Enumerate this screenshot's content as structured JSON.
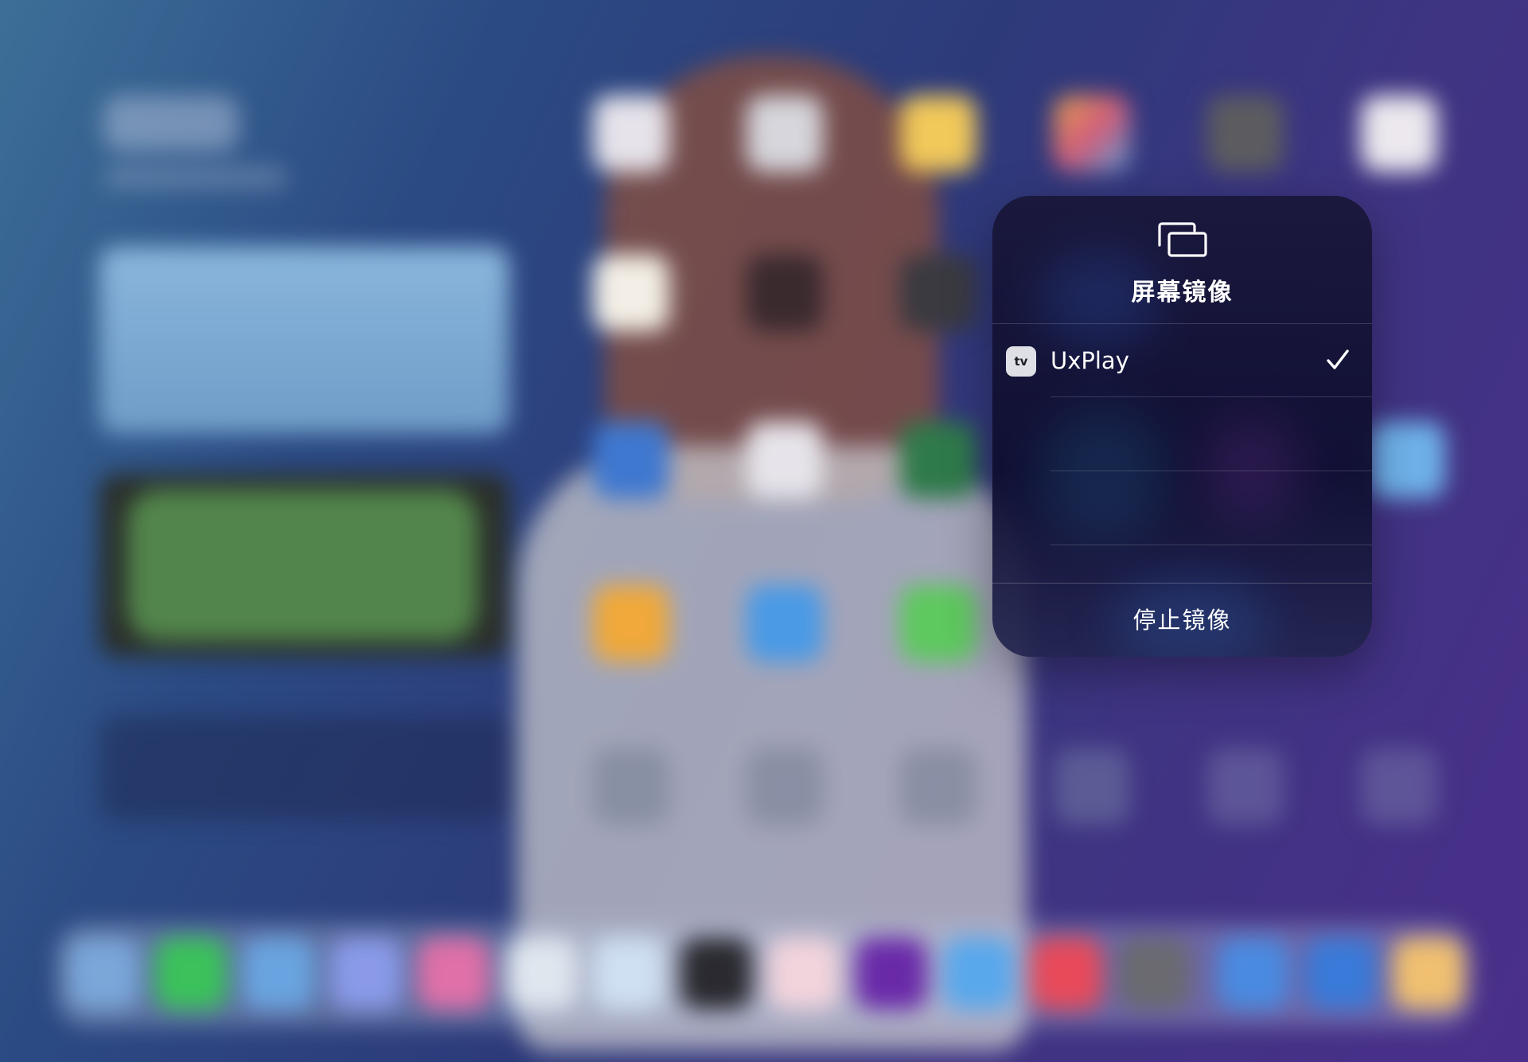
{
  "mirroring_panel": {
    "icon": "screen-mirroring-icon",
    "title": "屏幕镜像",
    "devices": [
      {
        "icon": "apple-tv-icon",
        "icon_text": "tv",
        "name": "UxPlay",
        "selected": true,
        "check_icon": "checkmark-icon"
      }
    ],
    "stop_label": "停止镜像"
  },
  "colors": {
    "panel_background": "#14143a",
    "text": "#ffffff",
    "divider": "#ffffff29",
    "wallpaper_left": "#3c6f98",
    "wallpaper_right": "#4a2f8a"
  }
}
